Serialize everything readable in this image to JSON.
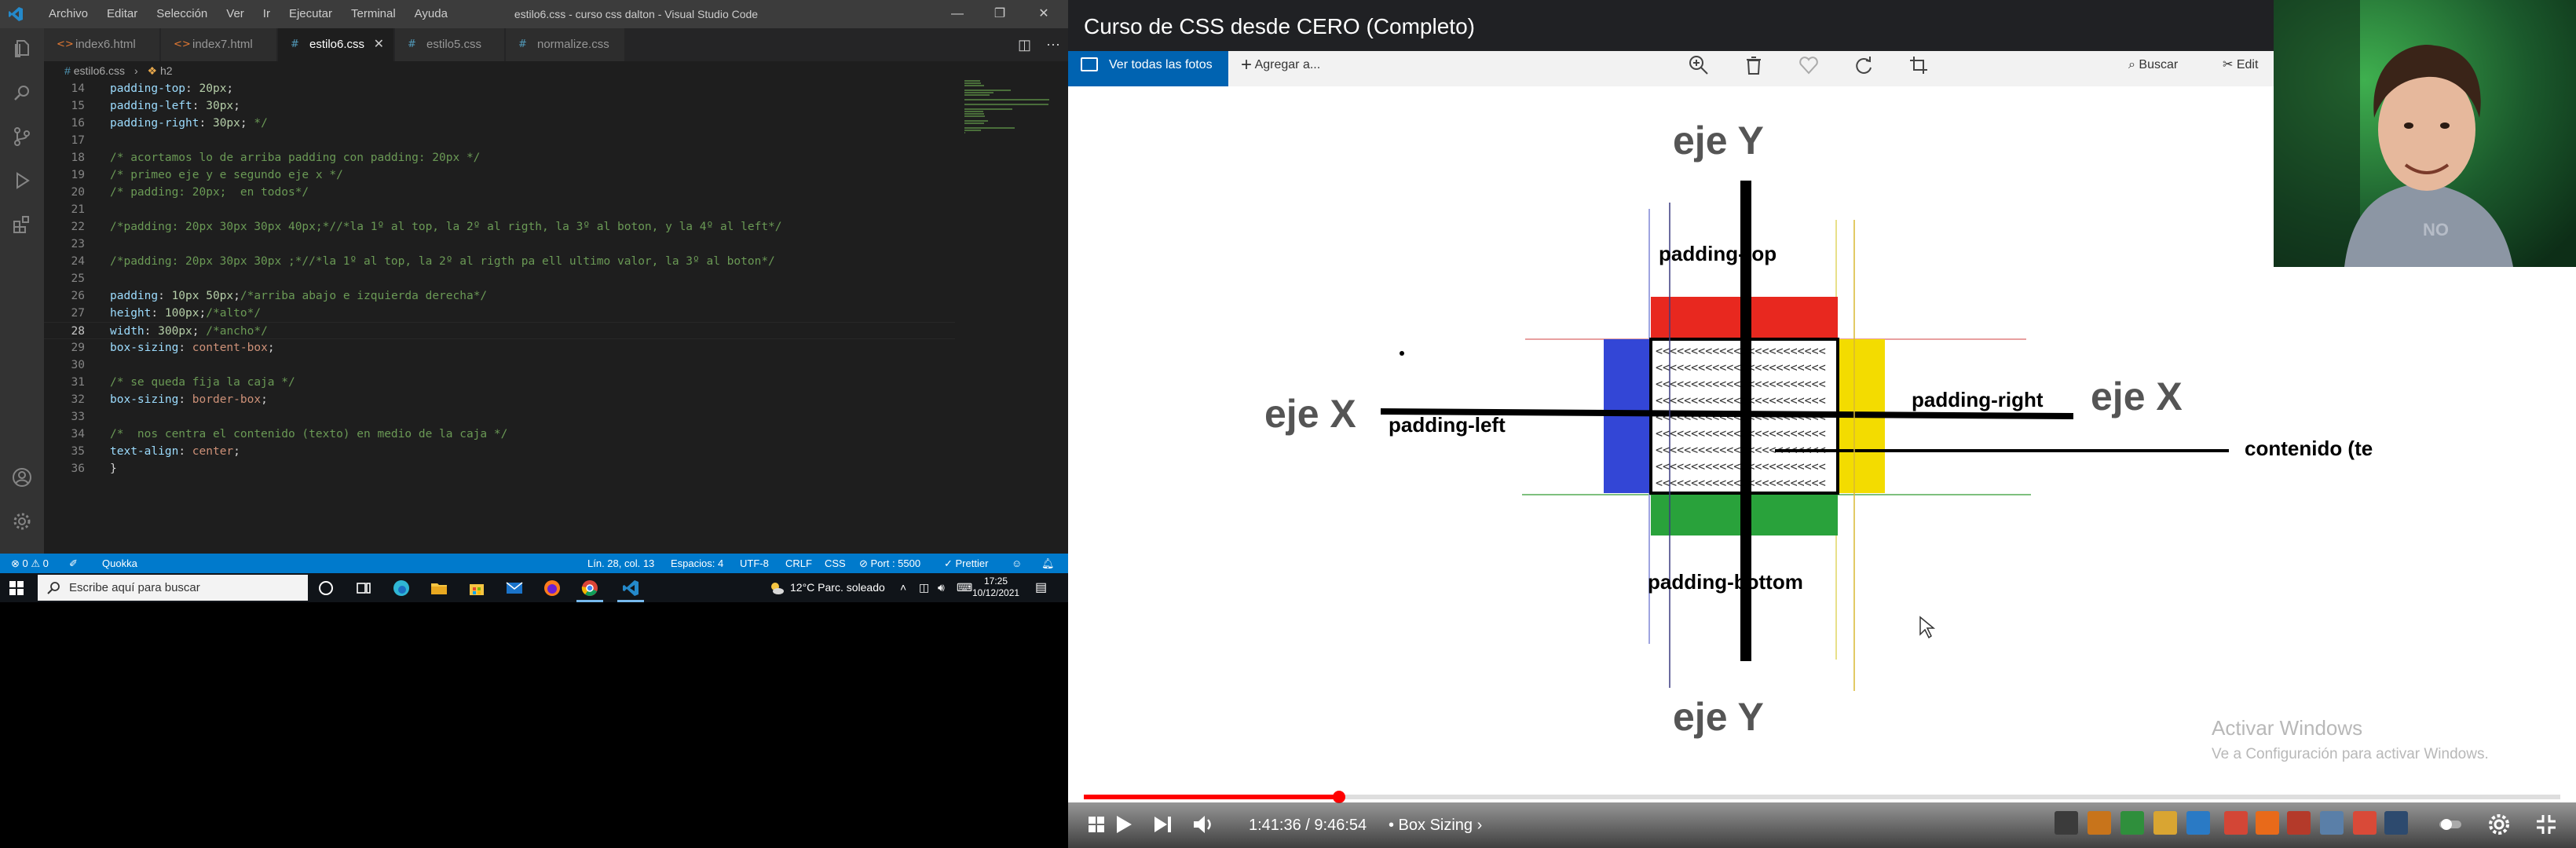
{
  "vscode": {
    "menu": [
      "Archivo",
      "Editar",
      "Selección",
      "Ver",
      "Ir",
      "Ejecutar",
      "Terminal",
      "Ayuda"
    ],
    "window_title": "estilo6.css - curso css dalton - Visual Studio Code",
    "tabs": [
      {
        "label": "index6.html",
        "icon": "<>",
        "active": false
      },
      {
        "label": "index7.html",
        "icon": "<>",
        "active": false
      },
      {
        "label": "estilo6.css",
        "icon": "#",
        "active": true
      },
      {
        "label": "estilo5.css",
        "icon": "#",
        "active": false
      },
      {
        "label": "normalize.css",
        "icon": "#",
        "active": false
      }
    ],
    "breadcrumb": {
      "file": "estilo6.css",
      "symbol": "h2"
    },
    "code": [
      {
        "n": "14",
        "parts": [
          [
            "prop",
            "padding-top"
          ],
          [
            "punc",
            ": "
          ],
          [
            "num",
            "20px"
          ],
          [
            "punc",
            ";"
          ]
        ],
        "indent": "    "
      },
      {
        "n": "15",
        "parts": [
          [
            "prop",
            "padding-left"
          ],
          [
            "punc",
            ": "
          ],
          [
            "num",
            "30px"
          ],
          [
            "punc",
            ";"
          ]
        ],
        "indent": "    "
      },
      {
        "n": "16",
        "parts": [
          [
            "prop",
            "padding-right"
          ],
          [
            "punc",
            ": "
          ],
          [
            "num",
            "30px"
          ],
          [
            "punc",
            "; "
          ],
          [
            "com",
            "*/"
          ]
        ],
        "indent": "    "
      },
      {
        "n": "17",
        "parts": [],
        "indent": ""
      },
      {
        "n": "18",
        "parts": [
          [
            "com",
            "/* acortamos lo de arriba padding con padding: 20px */"
          ]
        ],
        "indent": "    "
      },
      {
        "n": "19",
        "parts": [
          [
            "com",
            "/* primeo eje y e segundo eje x */"
          ]
        ],
        "indent": "    "
      },
      {
        "n": "20",
        "parts": [
          [
            "com",
            "/* padding: 20px;  en todos*/"
          ]
        ],
        "indent": "    "
      },
      {
        "n": "21",
        "parts": [],
        "indent": ""
      },
      {
        "n": "22",
        "parts": [
          [
            "com",
            "/*padding: 20px 30px 30px 40px;*//*la 1º al top, la 2º al rigth, la 3º al boton, y la 4º al left*/"
          ]
        ],
        "indent": "    "
      },
      {
        "n": "23",
        "parts": [],
        "indent": ""
      },
      {
        "n": "24",
        "parts": [
          [
            "com",
            "/*padding: 20px 30px 30px ;*//*la 1º al top, la 2º al rigth pa ell ultimo valor, la 3º al boton*/"
          ]
        ],
        "indent": "    "
      },
      {
        "n": "25",
        "parts": [],
        "indent": ""
      },
      {
        "n": "26",
        "parts": [
          [
            "prop",
            "padding"
          ],
          [
            "punc",
            ": "
          ],
          [
            "num",
            "10px 50px"
          ],
          [
            "punc",
            ";"
          ],
          [
            "com",
            "/*arriba abajo e izquierda derecha*/"
          ]
        ],
        "indent": "    "
      },
      {
        "n": "27",
        "parts": [
          [
            "prop",
            "height"
          ],
          [
            "punc",
            ": "
          ],
          [
            "num",
            "100px"
          ],
          [
            "punc",
            ";"
          ],
          [
            "com",
            "/*alto*/"
          ]
        ],
        "indent": "    "
      },
      {
        "n": "28",
        "parts": [
          [
            "prop",
            "width"
          ],
          [
            "punc",
            ": "
          ],
          [
            "num",
            "300px"
          ],
          [
            "punc",
            "; "
          ],
          [
            "com",
            "/*ancho*/"
          ]
        ],
        "indent": "    ",
        "current": true
      },
      {
        "n": "29",
        "parts": [
          [
            "prop",
            "box-sizing"
          ],
          [
            "punc",
            ": "
          ],
          [
            "val",
            "content-box"
          ],
          [
            "punc",
            ";"
          ]
        ],
        "indent": "    "
      },
      {
        "n": "30",
        "parts": [],
        "indent": ""
      },
      {
        "n": "31",
        "parts": [
          [
            "com",
            "/* se queda fija la caja */"
          ]
        ],
        "indent": "    "
      },
      {
        "n": "32",
        "parts": [
          [
            "prop",
            "box-sizing"
          ],
          [
            "punc",
            ": "
          ],
          [
            "val",
            "border-box"
          ],
          [
            "punc",
            ";"
          ]
        ],
        "indent": "    "
      },
      {
        "n": "33",
        "parts": [],
        "indent": ""
      },
      {
        "n": "34",
        "parts": [
          [
            "com",
            "/*  nos centra el contenido (texto) en medio de la caja */"
          ]
        ],
        "indent": "    "
      },
      {
        "n": "35",
        "parts": [
          [
            "prop",
            "text-align"
          ],
          [
            "punc",
            ": "
          ],
          [
            "val",
            "center"
          ],
          [
            "punc",
            ";"
          ]
        ],
        "indent": "    "
      },
      {
        "n": "36",
        "parts": [
          [
            "punc",
            "}"
          ]
        ],
        "indent": ""
      }
    ],
    "status": {
      "problems": "⊗ 0 ⚠ 0",
      "quokka": "Quokka",
      "position": "Lín. 28, col. 13",
      "spaces": "Espacios: 4",
      "encoding": "UTF-8",
      "eol": "CRLF",
      "language": "CSS",
      "port": "⊘ Port : 5500",
      "prettier": "✓ Prettier"
    }
  },
  "taskbar": {
    "search_placeholder": "Escribe aquí para buscar",
    "weather": "12°C  Parc. soleado",
    "time": "17:25",
    "date": "10/12/2021"
  },
  "video": {
    "title": "Curso de CSS desde CERO (Completo)",
    "photos_albums": "Ver todas las fotos",
    "photos_add": "Agregar a...",
    "photos_search": "Buscar",
    "photos_edit": "Edit",
    "diagram": {
      "eje_y_top": "eje Y",
      "eje_y_bottom": "eje Y",
      "eje_x_left": "eje X",
      "eje_x_right": "eje X",
      "padding_top": "padding-top",
      "padding_bottom": "padding-bottom",
      "padding_left": "padding-left",
      "padding_right": "padding-right",
      "contenido": "contenido (te"
    },
    "watermark_title": "Activar Windows",
    "watermark_sub": "Ve a Configuración para activar Windows.",
    "time": "1:41:36 / 9:46:54",
    "chapter": "• Box Sizing ›",
    "progress": 0.173,
    "colors": {
      "top": "#e8281f",
      "bottom": "#29a23b",
      "left": "#3346d6",
      "right": "#f3dc00"
    }
  }
}
